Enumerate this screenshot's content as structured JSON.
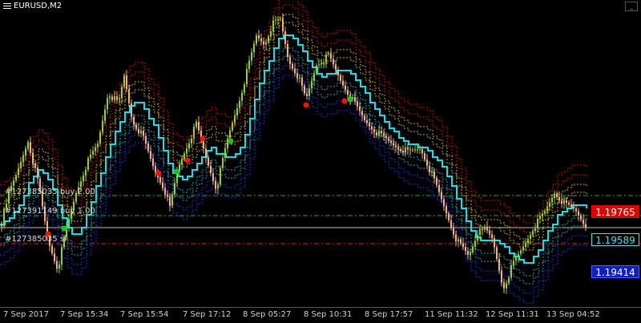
{
  "window": {
    "title": "EURUSD,M2",
    "menu_icon": "menu-icon"
  },
  "orders": [
    {
      "label": "#127385035 buy 2.00",
      "color": "#2ea32e"
    },
    {
      "label": "#127391149 buy 1.00",
      "color": "#2ea32e"
    },
    {
      "label": "#127385035 sl",
      "color": "#e02020"
    }
  ],
  "price_labels": [
    {
      "value": "1.19765",
      "bg": "#e00000",
      "fg": "#ffffff",
      "border": "#e00000"
    },
    {
      "value": "1.19589",
      "bg": "#000000",
      "fg": "#40e0f0",
      "border": "#40e0f0"
    },
    {
      "value": "1.19414",
      "bg": "#1020c0",
      "fg": "#ffffff",
      "border": "#4060ff"
    }
  ],
  "time_axis": [
    "7 Sep 2017",
    "7 Sep 15:34",
    "7 Sep 15:54",
    "7 Sep 17:12",
    "8 Sep 05:27",
    "8 Sep 10:31",
    "8 Sep 17:57",
    "11 Sep 11:32",
    "12 Sep 11:31",
    "13 Sep 04:52"
  ],
  "colors": {
    "background": "#000000",
    "candle_up": "#9acd32",
    "candle_down": "#f4b183",
    "midline": "#00e5ee",
    "upper_band_inner": "#d4aa00",
    "upper_band_outer": "#c01010",
    "lower_band_inner": "#20a0c0",
    "lower_band_outer": "#2030d0",
    "buy_line": "#2ea32e",
    "sl_line": "#e02020",
    "current_price_line": "#c0c0c0",
    "signal_buy": "#20c020",
    "signal_sell": "#ff1010"
  }
}
